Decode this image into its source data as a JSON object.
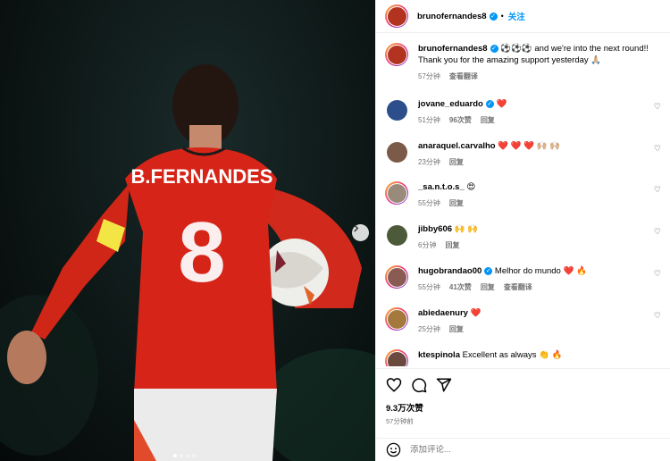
{
  "post": {
    "author": "brunofernandes8",
    "follow_label": "关注",
    "dot": "•",
    "caption": "⚽️⚽️⚽️ and we're into the next round!! Thank you for the amazing support yesterday 🙏🏼",
    "caption_time": "57分钟",
    "caption_translate": "查看翻译",
    "jersey_name": "B.FERNANDES",
    "jersey_number": "8",
    "likes": "9.3万次赞",
    "posted_ago": "57分钟前",
    "carousel": {
      "total": 4,
      "active": 1
    }
  },
  "comments": [
    {
      "user": "jovane_eduardo",
      "verified": true,
      "text": "❤️",
      "time": "51分钟",
      "likes": "96次赞",
      "reply": "回复",
      "translate": ""
    },
    {
      "user": "anaraquel.carvalho",
      "verified": false,
      "text": "❤️ ❤️ ❤️ 🙌🏼 🙌🏼",
      "time": "23分钟",
      "likes": "",
      "reply": "回复",
      "translate": ""
    },
    {
      "user": "_sa.n.t.o.s_",
      "verified": false,
      "text": "😍",
      "time": "55分钟",
      "likes": "",
      "reply": "回复",
      "translate": ""
    },
    {
      "user": "jibby606",
      "verified": false,
      "text": "🙌 🙌",
      "time": "6分钟",
      "likes": "",
      "reply": "回复",
      "translate": ""
    },
    {
      "user": "hugobrandao00",
      "verified": true,
      "text": "Melhor do mundo ❤️ 🔥",
      "time": "55分钟",
      "likes": "41次赞",
      "reply": "回复",
      "translate": "查看翻译"
    },
    {
      "user": "abiedaenury",
      "verified": false,
      "text": "❤️",
      "time": "25分钟",
      "likes": "",
      "reply": "回复",
      "translate": ""
    },
    {
      "user": "ktespinola",
      "verified": false,
      "text": "Excellent as always 👏 🔥",
      "time": "",
      "likes": "",
      "reply": "",
      "translate": ""
    }
  ],
  "add_comment": {
    "placeholder": "添加评论..."
  },
  "icons": {
    "heart": "heart-icon",
    "comment": "comment-icon",
    "share": "share-icon",
    "emoji": "emoji-icon",
    "next": "chevron-right-icon"
  },
  "colors": {
    "accent": "#0095f6",
    "jersey": "#d62418",
    "like_red": "#ff3040"
  }
}
